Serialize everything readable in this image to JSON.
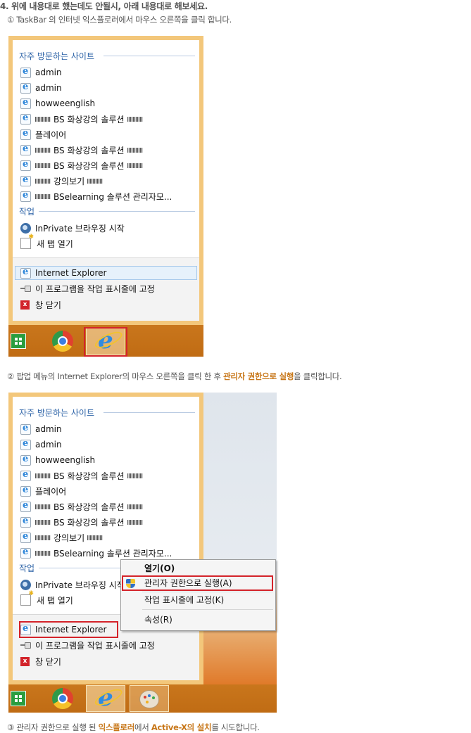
{
  "heading": {
    "step4": "4. 위에 내용대로 했는데도 안될시, 아래 내용대로 해보세요.",
    "step1": "① TaskBar 의 인터넷 익스플로러에서 마우스 오른쪽을 클릭 합니다.",
    "step2_pre": "② 팝업 메뉴의 Internet Explorer의 마우스 오른쪽을 클릭 한 후 ",
    "step2_em": "관리자 권한으로 실행",
    "step2_post": "을 클릭합니다.",
    "step3_pre": "③ 관리자 권한으로 실행 된 ",
    "step3_em1": "익스플로러",
    "step3_mid": "에서 ",
    "step3_em2": "Active-X의 설치",
    "step3_post": "를 시도합니다."
  },
  "jumplist": {
    "frequent_header": "자주 방문하는 사이트",
    "frequent": [
      {
        "pre": "",
        "text": "admin",
        "post": ""
      },
      {
        "pre": "",
        "text": "admin",
        "post": ""
      },
      {
        "pre": "",
        "text": "howweenglish",
        "post": ""
      },
      {
        "pre": "blur",
        "text": "BS 화상강의 솔루션",
        "post": "blur"
      },
      {
        "pre": "",
        "text": "플레이어",
        "post": ""
      },
      {
        "pre": "blur",
        "text": "BS 화상강의 솔루션",
        "post": "blur"
      },
      {
        "pre": "blur",
        "text": "BS 화상강의 솔루션",
        "post": "blur"
      },
      {
        "pre": "blur",
        "text": "강의보기",
        "post": "blur"
      },
      {
        "pre": "blur",
        "text": "BSelearning 솔루션 관리자모...",
        "post": ""
      }
    ],
    "tasks_header": "작업",
    "tasks": [
      "InPrivate 브라우징 시작",
      "새 탭 열기"
    ],
    "app_name": "Internet Explorer",
    "pin_label": "이 프로그램을 작업 표시줄에 고정",
    "close_label": "창 닫기"
  },
  "jumplist2": {
    "tasks": [
      "InPrivate 브라우징 시작",
      "새 탭 열기"
    ]
  },
  "context_menu": {
    "open": "열기(O)",
    "run_as_admin": "관리자 권한으로 실행(A)",
    "pin_taskbar": "작업 표시줄에 고정(K)",
    "properties": "속성(R)"
  },
  "taskbar": {
    "icons": [
      "windows-store-icon",
      "chrome-icon",
      "internet-explorer-icon",
      "paint-icon"
    ]
  },
  "colors": {
    "frame": "#f3c77b",
    "taskbar": "#c9761c",
    "highlight_red": "#d4232a",
    "section_blue": "#2d63a7",
    "accent_green": "#5f9a1c",
    "accent_orange": "#c8781b"
  }
}
